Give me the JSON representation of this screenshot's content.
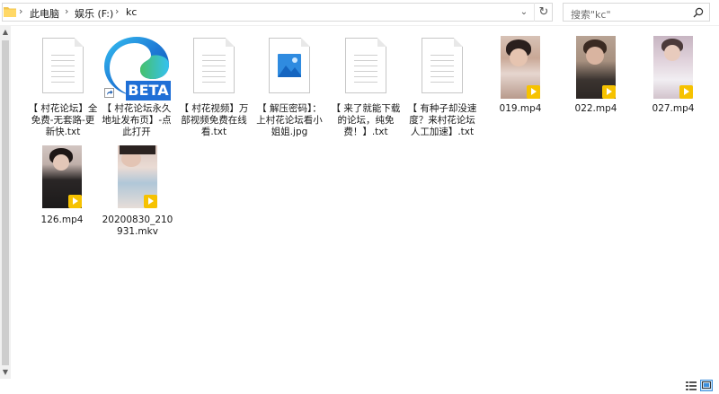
{
  "address": {
    "crumbs": [
      "此电脑",
      "娱乐 (F:)",
      "kc"
    ],
    "separator": "›"
  },
  "search": {
    "placeholder": "搜索\"kc\""
  },
  "items": [
    {
      "type": "txt",
      "label": "【 村花论坛】全免费-无套路-更新快.txt"
    },
    {
      "type": "edge",
      "label": "【 村花论坛永久地址发布页】-点此打开",
      "badge": "BETA"
    },
    {
      "type": "txt",
      "label": "【 村花视频】万部视频免费在线看.txt"
    },
    {
      "type": "jpg",
      "label": "【 解压密码】：上村花论坛看小姐姐.jpg"
    },
    {
      "type": "txt",
      "label": "【 来了就能下载的论坛，纯免费！】.txt"
    },
    {
      "type": "txt",
      "label": "【 有种子却没速度？来村花论坛人工加速】.txt"
    },
    {
      "type": "video",
      "label": "019.mp4"
    },
    {
      "type": "video",
      "label": "022.mp4"
    },
    {
      "type": "video",
      "label": "027.mp4"
    },
    {
      "type": "video",
      "label": "126.mp4"
    },
    {
      "type": "video",
      "label": "20200830_210931.mkv"
    }
  ],
  "colors": {
    "edge_blue": "#1f7ad6",
    "edge_green": "#47c16a",
    "play_badge": "#f6c200"
  }
}
